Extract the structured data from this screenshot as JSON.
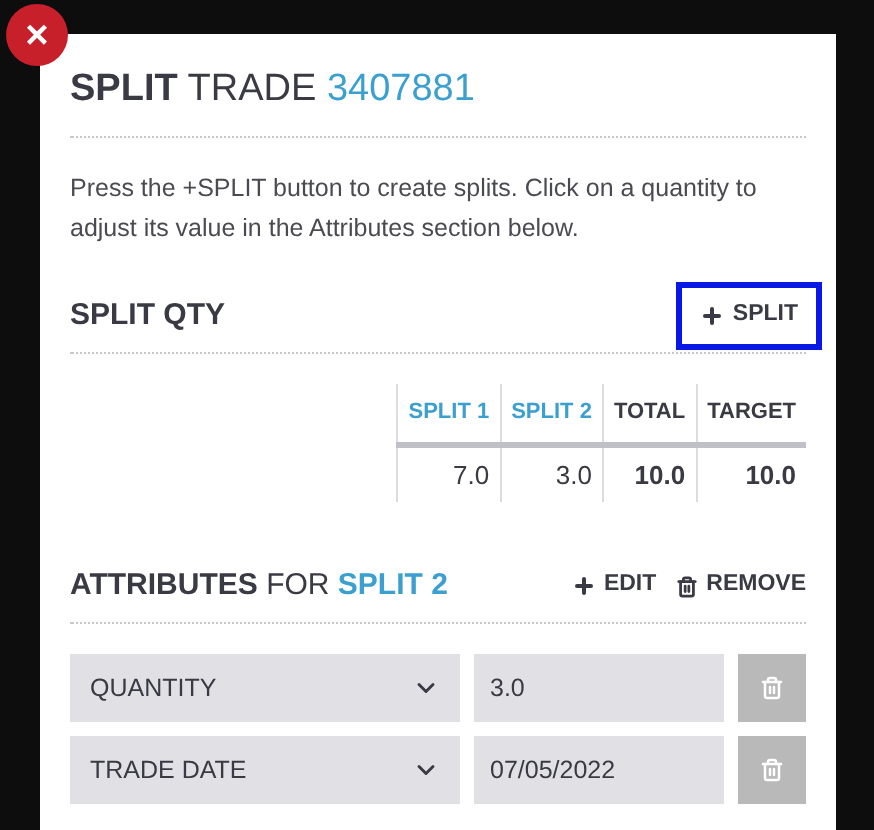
{
  "close_button": {
    "label": "×"
  },
  "title": {
    "strong": "SPLIT",
    "rest": "TRADE",
    "trade_id": "3407881"
  },
  "instructions": "Press the +SPLIT button to create splits. Click on a quantity to adjust its value in the Attributes section below.",
  "split_qty": {
    "heading": "SPLIT QTY",
    "add_button": {
      "label": "SPLIT",
      "focused": true
    },
    "columns": [
      {
        "label": "SPLIT 1",
        "kind": "split"
      },
      {
        "label": "SPLIT 2",
        "kind": "split"
      },
      {
        "label": "TOTAL",
        "kind": "sum"
      },
      {
        "label": "TARGET",
        "kind": "sum"
      }
    ],
    "values": [
      "7.0",
      "3.0",
      "10.0",
      "10.0"
    ]
  },
  "attributes": {
    "heading_strong": "ATTRIBUTES",
    "heading_rest": "FOR",
    "split_name": "SPLIT 2",
    "edit_button": "EDIT",
    "remove_button": "REMOVE",
    "rows": [
      {
        "attribute": "QUANTITY",
        "value": "3.0"
      },
      {
        "attribute": "TRADE DATE",
        "value": "07/05/2022"
      }
    ]
  }
}
